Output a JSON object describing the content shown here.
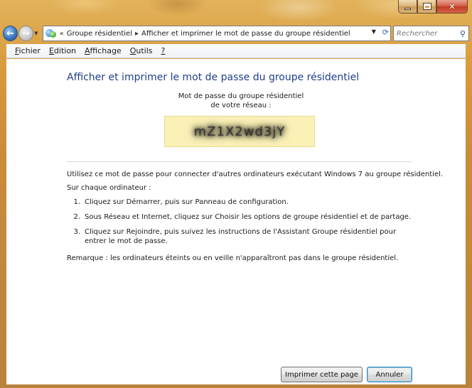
{
  "window": {
    "caption_buttons": [
      "minimize",
      "maximize",
      "close"
    ]
  },
  "address_bar": {
    "overflow": "«",
    "crumbs": [
      "Groupe résidentiel",
      "Afficher et imprimer le mot de passe du groupe résidentiel"
    ],
    "separator": "▸"
  },
  "search": {
    "placeholder": "Rechercher"
  },
  "menu": {
    "items": [
      {
        "label": "Fichier",
        "accel": "F",
        "rest": "ichier"
      },
      {
        "label": "Edition",
        "accel": "E",
        "rest": "dition"
      },
      {
        "label": "Affichage",
        "accel": "A",
        "rest": "ffichage"
      },
      {
        "label": "Outils",
        "accel": "O",
        "rest": "utils"
      },
      {
        "label": "?",
        "accel": "?",
        "rest": ""
      }
    ]
  },
  "page": {
    "title": "Afficher et imprimer le mot de passe du groupe résidentiel",
    "password_caption_line1": "Mot de passe du groupe résidentiel",
    "password_caption_line2": "de votre réseau :",
    "password_value": "mZ1X2wd3jY",
    "intro": "Utilisez ce mot de passe pour connecter d'autres ordinateurs exécutant Windows 7 au groupe résidentiel.",
    "each_computer": "Sur chaque ordinateur :",
    "steps": [
      {
        "num": "1.",
        "text": "Cliquez sur Démarrer, puis sur Panneau de configuration."
      },
      {
        "num": "2.",
        "text": "Sous Réseau et Internet, cliquez sur Choisir les options de groupe résidentiel et de partage."
      },
      {
        "num": "3.",
        "text": "Cliquez sur Rejoindre, puis suivez les instructions de l'Assistant Groupe résidentiel pour entrer le mot de passe."
      }
    ],
    "note": "Remarque : les ordinateurs éteints ou en veille n'apparaîtront pas dans le groupe résidentiel."
  },
  "buttons": {
    "print": "Imprimer cette page",
    "cancel": "Annuler"
  },
  "colors": {
    "title_blue": "#1f3f88",
    "password_bg": "#fbf1b7",
    "frame": "#c98c3a"
  }
}
